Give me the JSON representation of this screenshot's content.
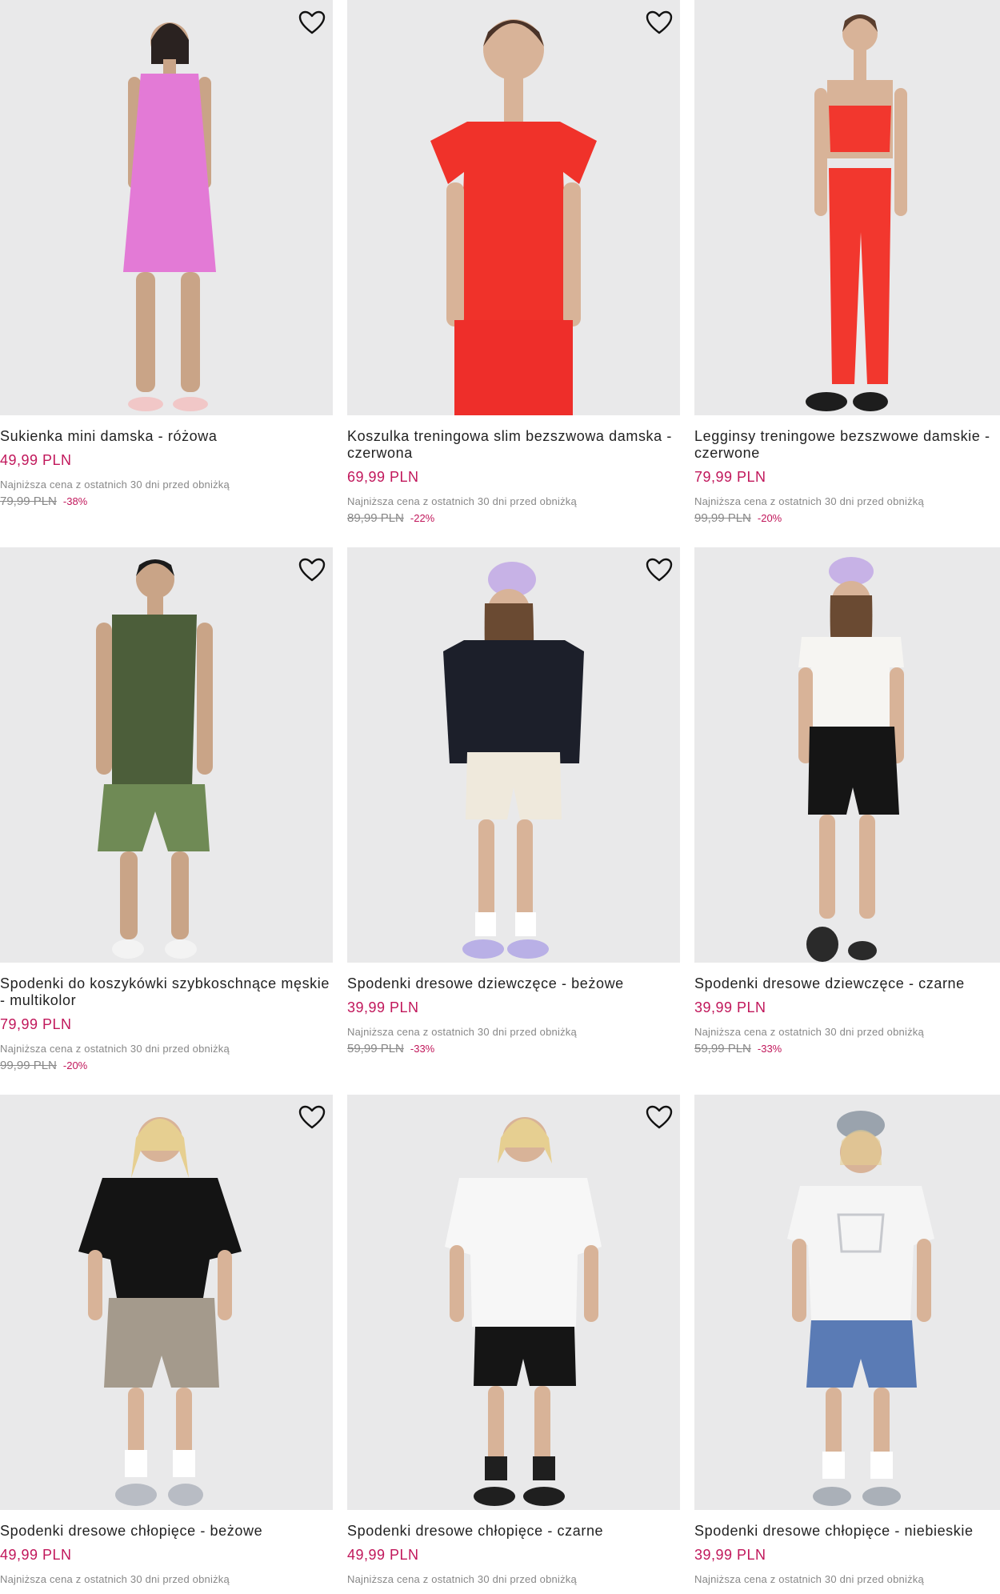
{
  "products": [
    {
      "title": "Sukienka mini damska - różowa",
      "price": "49,99 PLN",
      "lowest_label": "Najniższa cena z ostatnich 30 dni przed obniżką",
      "old_price": "79,99 PLN",
      "discount": "-38%",
      "colors": {
        "top": "#e37ad6",
        "bottom": "#e37ad6",
        "shoes": "#f1c7c7"
      }
    },
    {
      "title": "Koszulka treningowa slim bezszwowa damska - czerwona",
      "price": "69,99 PLN",
      "lowest_label": "Najniższa cena z ostatnich 30 dni przed obniżką",
      "old_price": "89,99 PLN",
      "discount": "-22%",
      "colors": {
        "top": "#f0322a",
        "bottom": "#ee2e2a",
        "shoes": "#ee2e2a"
      }
    },
    {
      "title": "Legginsy treningowe bezszwowe damskie - czerwone",
      "price": "79,99 PLN",
      "lowest_label": "Najniższa cena z ostatnich 30 dni przed obniżką",
      "old_price": "99,99 PLN",
      "discount": "-20%",
      "colors": {
        "top": "#f2372e",
        "bottom": "#f2372e",
        "shoes": "#1d1d1d"
      }
    },
    {
      "title": "Spodenki do koszykówki szybkoschnące męskie - multikolor",
      "price": "79,99 PLN",
      "lowest_label": "Najniższa cena z ostatnich 30 dni przed obniżką",
      "old_price": "99,99 PLN",
      "discount": "-20%",
      "colors": {
        "top": "#4c5e3a",
        "bottom": "#6f8a55",
        "shoes": "#f3f3f3"
      }
    },
    {
      "title": "Spodenki dresowe dziewczęce - beżowe",
      "price": "39,99 PLN",
      "lowest_label": "Najniższa cena z ostatnich 30 dni przed obniżką",
      "old_price": "59,99 PLN",
      "discount": "-33%",
      "colors": {
        "top": "#1c1f2a",
        "bottom": "#efe9dc",
        "shoes": "#b9b0e6"
      }
    },
    {
      "title": "Spodenki dresowe dziewczęce - czarne",
      "price": "39,99 PLN",
      "lowest_label": "Najniższa cena z ostatnich 30 dni przed obniżką",
      "old_price": "59,99 PLN",
      "discount": "-33%",
      "colors": {
        "top": "#f6f5f2",
        "bottom": "#151515",
        "shoes": "#2a2a2a"
      }
    },
    {
      "title": "Spodenki dresowe chłopięce - beżowe",
      "price": "49,99 PLN",
      "lowest_label": "Najniższa cena z ostatnich 30 dni przed obniżką",
      "old_price": "",
      "discount": "",
      "colors": {
        "top": "#141414",
        "bottom": "#a49a8c",
        "shoes": "#b8bcc4"
      }
    },
    {
      "title": "Spodenki dresowe chłopięce - czarne",
      "price": "49,99 PLN",
      "lowest_label": "Najniższa cena z ostatnich 30 dni przed obniżką",
      "old_price": "",
      "discount": "",
      "colors": {
        "top": "#f7f7f7",
        "bottom": "#151515",
        "shoes": "#1f1f1f"
      }
    },
    {
      "title": "Spodenki dresowe chłopięce - niebieskie",
      "price": "39,99 PLN",
      "lowest_label": "Najniższa cena z ostatnich 30 dni przed obniżką",
      "old_price": "",
      "discount": "",
      "colors": {
        "top": "#f5f5f5",
        "bottom": "#5a7bb5",
        "shoes": "#aab0b8"
      }
    }
  ],
  "icons": {
    "favorite": "heart-outline-icon"
  },
  "accent_color": "#c1175b"
}
